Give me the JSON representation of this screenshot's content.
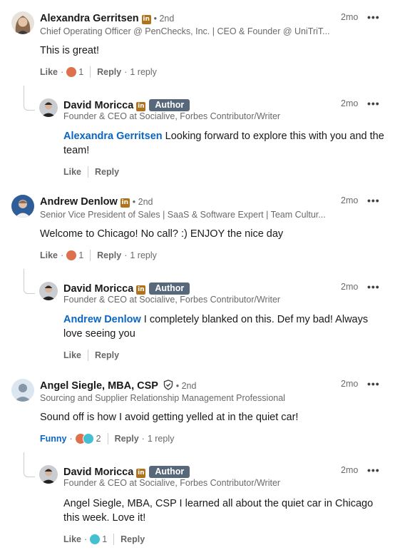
{
  "comments": [
    {
      "name": "Alexandra Gerritsen",
      "degree": "• 2nd",
      "headline": "Chief Operating Officer @ PenChecks, Inc. | CEO & Founder @ UniTriT...",
      "time": "2mo",
      "text": "This is great!",
      "like_label": "Like",
      "reaction_count": "1",
      "reply_label": "Reply",
      "replies_label": "1 reply",
      "reply": {
        "name": "David Moricca",
        "author_badge": "Author",
        "headline": "Founder & CEO at Socialive, Forbes Contributor/Writer",
        "time": "2mo",
        "mention": "Alexandra Gerritsen",
        "text_line1": " Looking forward to explore this with you and the",
        "text_line2": "team!",
        "like_label": "Like",
        "reply_label": "Reply"
      }
    },
    {
      "name": "Andrew Denlow",
      "degree": "• 2nd",
      "headline": "Senior Vice President of Sales | SaaS & Software Expert | Team Cultur...",
      "time": "2mo",
      "text": "Welcome to Chicago! No call? :) ENJOY the nice day",
      "like_label": "Like",
      "reaction_count": "1",
      "reply_label": "Reply",
      "replies_label": "1 reply",
      "reply": {
        "name": "David Moricca",
        "author_badge": "Author",
        "headline": "Founder & CEO at Socialive, Forbes Contributor/Writer",
        "time": "2mo",
        "mention": "Andrew Denlow",
        "text_line1": " I completely blanked on this. Def my bad! Always",
        "text_line2": "love seeing you",
        "like_label": "Like",
        "reply_label": "Reply"
      }
    },
    {
      "name": "Angel Siegle, MBA, CSP",
      "degree": "• 2nd",
      "headline": "Sourcing and Supplier Relationship Management Professional",
      "time": "2mo",
      "text": "Sound off is how I avoid getting yelled at in the quiet car!",
      "like_label": "Funny",
      "reaction_count": "2",
      "reply_label": "Reply",
      "replies_label": "1 reply",
      "reply": {
        "name": "David Moricca",
        "author_badge": "Author",
        "headline": "Founder & CEO at Socialive, Forbes Contributor/Writer",
        "time": "2mo",
        "text_line1": "Angel Siegle, MBA, CSP I learned all about the quiet car in Chicago",
        "text_line2": "this week. Love it!",
        "like_label": "Like",
        "reaction_count": "1",
        "reply_label": "Reply"
      }
    }
  ],
  "icons": {
    "linkedin_badge": "in",
    "more": "•••",
    "love_color": "#df704d",
    "funny_color": "#44c0d1",
    "link_color": "#0a66c2",
    "author_badge_color": "#56687a",
    "premium_badge_color": "#b0731d"
  }
}
